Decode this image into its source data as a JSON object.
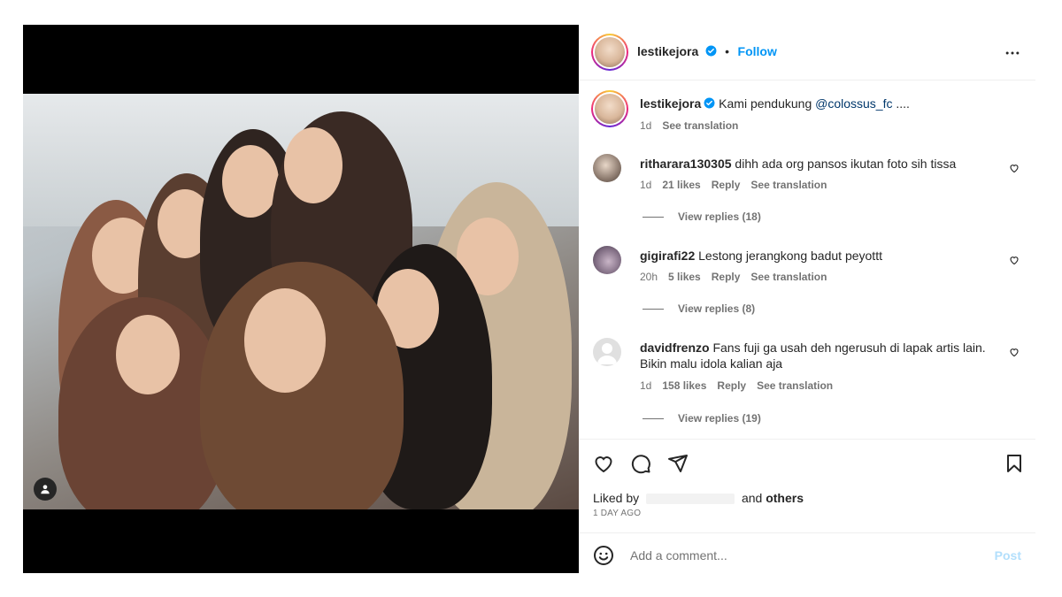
{
  "post": {
    "username": "lestikejora",
    "follow_label": "Follow",
    "more_label": "…",
    "caption": {
      "username": "lestikejora",
      "text_prefix": "Kami pendukung",
      "mention": "@colossus_fc",
      "text_suffix": "....",
      "age": "1d",
      "see_translation": "See translation"
    }
  },
  "comments": [
    {
      "username": "ritharara130305",
      "text": "dihh ada org pansos ikutan foto sih tissa",
      "age": "1d",
      "likes": "21 likes",
      "reply": "Reply",
      "see_translation": "See translation",
      "view_replies": "View replies (18)"
    },
    {
      "username": "gigirafi22",
      "text": "Lestong jerangkong badut peyottt",
      "age": "20h",
      "likes": "5 likes",
      "reply": "Reply",
      "see_translation": "See translation",
      "view_replies": "View replies (8)"
    },
    {
      "username": "davidfrenzo",
      "text": "Fans fuji ga usah deh ngerusuh di lapak artis lain. Bikin malu idola kalian aja",
      "age": "1d",
      "likes": "158 likes",
      "reply": "Reply",
      "see_translation": "See translation",
      "view_replies": "View replies (19)"
    }
  ],
  "likes_section": {
    "liked_by_label": "Liked by",
    "and_label": "and",
    "others_label": "others",
    "time_ago": "1 DAY AGO"
  },
  "composer": {
    "placeholder": "Add a comment...",
    "post_label": "Post"
  },
  "icons": {
    "like": "heart-icon",
    "comment": "comment-icon",
    "share": "send-icon",
    "save": "bookmark-icon",
    "emoji": "emoji-icon",
    "verified": "verified-badge-icon",
    "user_tag": "user-tag-icon"
  },
  "colors": {
    "accent": "#0095f6",
    "text": "#262626",
    "muted": "#737373",
    "post_disabled": "#b2dffc"
  }
}
